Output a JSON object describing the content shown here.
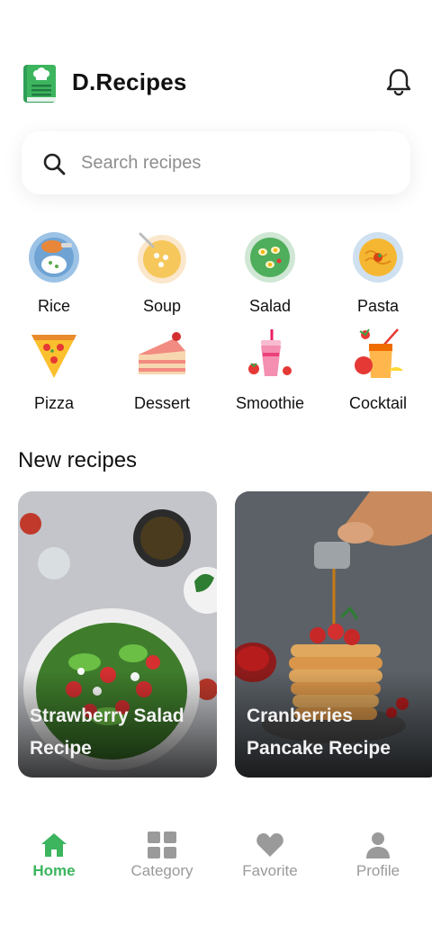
{
  "header": {
    "app_title": "D.Recipes"
  },
  "search": {
    "placeholder": "Search recipes"
  },
  "categories": [
    {
      "label": "Rice",
      "icon": "rice-bowl-icon"
    },
    {
      "label": "Soup",
      "icon": "soup-bowl-icon"
    },
    {
      "label": "Salad",
      "icon": "salad-bowl-icon"
    },
    {
      "label": "Pasta",
      "icon": "pasta-plate-icon"
    },
    {
      "label": "Pizza",
      "icon": "pizza-slice-icon"
    },
    {
      "label": "Dessert",
      "icon": "cake-slice-icon"
    },
    {
      "label": "Smoothie",
      "icon": "smoothie-cup-icon"
    },
    {
      "label": "Cocktail",
      "icon": "cocktail-glass-icon"
    }
  ],
  "new_recipes": {
    "title": "New recipes",
    "cards": [
      {
        "title": "Strawberry Salad Recipe"
      },
      {
        "title": "Cranberries Pancake Recipe"
      }
    ]
  },
  "nav": {
    "active": "Home",
    "items": [
      {
        "label": "Home",
        "icon": "home-icon"
      },
      {
        "label": "Category",
        "icon": "grid-icon"
      },
      {
        "label": "Favorite",
        "icon": "heart-icon"
      },
      {
        "label": "Profile",
        "icon": "user-icon"
      }
    ]
  },
  "colors": {
    "accent": "#3cb55e",
    "inactive": "#9a9a9a",
    "text": "#111111"
  }
}
